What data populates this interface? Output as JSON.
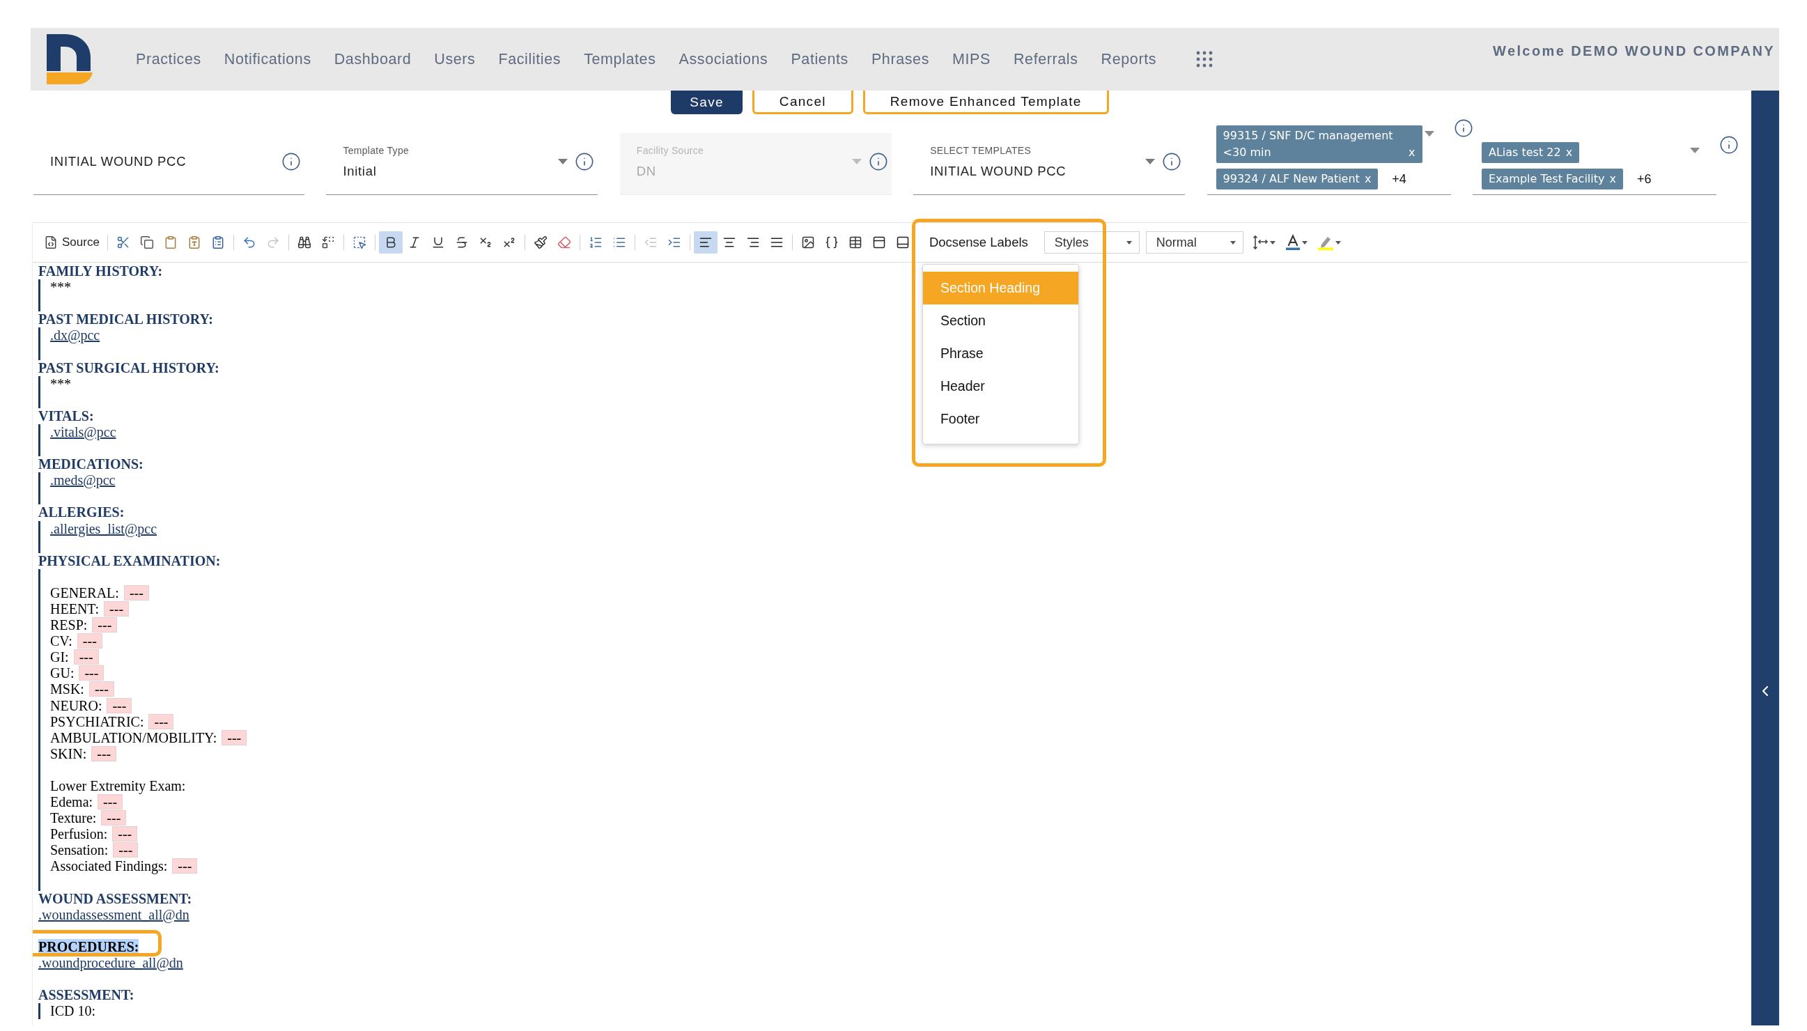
{
  "nav": {
    "items": [
      "Practices",
      "Notifications",
      "Dashboard",
      "Users",
      "Facilities",
      "Templates",
      "Associations",
      "Patients",
      "Phrases",
      "MIPS",
      "Referrals",
      "Reports"
    ],
    "welcome": "Welcome DEMO WOUND COMPANY"
  },
  "actions": [
    {
      "label": "Save",
      "kind": "primary"
    },
    {
      "label": "Cancel",
      "kind": "outline"
    },
    {
      "label": "Remove Enhanced Template",
      "kind": "outline"
    }
  ],
  "fields": [
    {
      "kind": "text",
      "value": "INITIAL WOUND PCC",
      "disabled": false
    },
    {
      "kind": "select",
      "label": "Template Type",
      "value": "Initial",
      "disabled": false
    },
    {
      "kind": "select",
      "label": "Facility Source",
      "value": "DN",
      "disabled": true
    },
    {
      "kind": "select",
      "label": "SELECT TEMPLATES",
      "value": "INITIAL WOUND PCC",
      "disabled": false
    },
    {
      "kind": "multiselect",
      "disabled": false,
      "chips": [
        {
          "label": "99315 / SNF D/C management <30 min",
          "remove": "x"
        },
        {
          "label": "99324 / ALF New Patient",
          "remove": "x"
        }
      ],
      "more": "+4"
    },
    {
      "kind": "multiselect",
      "disabled": false,
      "chips": [
        {
          "label": "ALias test 22",
          "remove": "x"
        },
        {
          "label": "Example Test Facility",
          "remove": "x"
        }
      ],
      "more": "+6"
    }
  ],
  "editor": {
    "toolbar": {
      "groups": [
        [
          {
            "kind": "source",
            "label": "Source",
            "active": false,
            "disabled": false
          }
        ],
        [
          {
            "kind": "cut",
            "active": false,
            "disabled": false
          },
          {
            "kind": "copy",
            "active": false,
            "disabled": false
          },
          {
            "kind": "paste",
            "active": false,
            "disabled": false
          },
          {
            "kind": "paste_text",
            "active": false,
            "disabled": false
          },
          {
            "kind": "paste_word",
            "active": false,
            "disabled": false
          }
        ],
        [
          {
            "kind": "undo",
            "active": false,
            "disabled": false
          },
          {
            "kind": "redo",
            "active": false,
            "disabled": true
          }
        ],
        [
          {
            "kind": "find",
            "active": false,
            "disabled": false
          },
          {
            "kind": "replace",
            "active": false,
            "disabled": false
          }
        ],
        [
          {
            "kind": "select_all",
            "active": false,
            "disabled": false
          }
        ],
        [
          {
            "kind": "bold",
            "active": true,
            "disabled": false
          },
          {
            "kind": "italic",
            "active": false,
            "disabled": false
          },
          {
            "kind": "underline",
            "active": false,
            "disabled": false
          },
          {
            "kind": "strike",
            "active": false,
            "disabled": false
          },
          {
            "kind": "subscript",
            "active": false,
            "disabled": false
          },
          {
            "kind": "superscript",
            "active": false,
            "disabled": false
          }
        ],
        [
          {
            "kind": "copy_format",
            "active": false,
            "disabled": false
          },
          {
            "kind": "remove_format",
            "active": false,
            "disabled": false
          }
        ],
        [
          {
            "kind": "numbered_list",
            "active": false,
            "disabled": false
          },
          {
            "kind": "bulleted_list",
            "active": false,
            "disabled": false
          }
        ],
        [
          {
            "kind": "outdent",
            "active": false,
            "disabled": true
          },
          {
            "kind": "indent",
            "active": false,
            "disabled": false
          }
        ],
        [
          {
            "kind": "align_left",
            "active": true,
            "disabled": false
          },
          {
            "kind": "align_center",
            "active": false,
            "disabled": false
          },
          {
            "kind": "align_right",
            "active": false,
            "disabled": false
          },
          {
            "kind": "align_justify",
            "active": false,
            "disabled": false
          }
        ],
        [
          {
            "kind": "image",
            "active": false,
            "disabled": false
          },
          {
            "kind": "placeholder",
            "active": false,
            "disabled": false
          },
          {
            "kind": "table",
            "active": false,
            "disabled": false
          },
          {
            "kind": "header_block",
            "active": false,
            "disabled": false
          },
          {
            "kind": "footer_block",
            "active": false,
            "disabled": false
          }
        ]
      ],
      "labels_menu": {
        "label": "Docsense Labels",
        "annotated": true,
        "items": [
          {
            "label": "Section Heading",
            "selected": true
          },
          {
            "label": "Section",
            "selected": false
          },
          {
            "label": "Phrase",
            "selected": false
          },
          {
            "label": "Header",
            "selected": false
          },
          {
            "label": "Footer",
            "selected": false
          }
        ]
      },
      "combos": [
        {
          "value": "Styles"
        },
        {
          "value": "Normal"
        }
      ],
      "tools": [
        {
          "kind": "line_height",
          "active": false
        },
        {
          "kind": "text_color",
          "active": false
        },
        {
          "kind": "bg_color",
          "active": false
        }
      ]
    },
    "sections": [
      {
        "heading": "FAMILY HISTORY:",
        "selected": false,
        "annotated": false,
        "indented": true,
        "lines": [
          {
            "kind": "text",
            "text": "***"
          }
        ]
      },
      {
        "heading": "PAST MEDICAL HISTORY:",
        "selected": false,
        "annotated": false,
        "indented": true,
        "lines": [
          {
            "kind": "link",
            "text": ".dx@pcc"
          }
        ]
      },
      {
        "heading": "PAST SURGICAL HISTORY:",
        "selected": false,
        "annotated": false,
        "indented": true,
        "lines": [
          {
            "kind": "text",
            "text": "***"
          }
        ]
      },
      {
        "heading": "VITALS:",
        "selected": false,
        "annotated": false,
        "indented": true,
        "lines": [
          {
            "kind": "link",
            "text": ".vitals@pcc"
          }
        ]
      },
      {
        "heading": "MEDICATIONS:",
        "selected": false,
        "annotated": false,
        "indented": true,
        "lines": [
          {
            "kind": "link",
            "text": ".meds@pcc"
          }
        ]
      },
      {
        "heading": "ALLERGIES:",
        "selected": false,
        "annotated": false,
        "indented": true,
        "lines": [
          {
            "kind": "link",
            "text": ".allergies_list@pcc"
          }
        ]
      },
      {
        "heading": "PHYSICAL EXAMINATION:",
        "selected": false,
        "annotated": false,
        "indented": true,
        "lines": [
          {
            "kind": "break"
          },
          {
            "kind": "field",
            "label": "GENERAL:",
            "value": "---"
          },
          {
            "kind": "field",
            "label": "HEENT:",
            "value": "---"
          },
          {
            "kind": "field",
            "label": "RESP:",
            "value": "---"
          },
          {
            "kind": "field",
            "label": "CV:",
            "value": "---"
          },
          {
            "kind": "field",
            "label": "GI:",
            "value": "---"
          },
          {
            "kind": "field",
            "label": "GU:",
            "value": "---"
          },
          {
            "kind": "field",
            "label": "MSK:",
            "value": "---"
          },
          {
            "kind": "field",
            "label": "NEURO:",
            "value": "---"
          },
          {
            "kind": "field",
            "label": "PSYCHIATRIC:",
            "value": "---"
          },
          {
            "kind": "field",
            "label": "AMBULATION/MOBILITY:",
            "value": "---"
          },
          {
            "kind": "field",
            "label": "SKIN:",
            "value": "---"
          },
          {
            "kind": "break"
          },
          {
            "kind": "text",
            "text": "Lower Extremity Exam:"
          },
          {
            "kind": "field",
            "label": "Edema:",
            "value": "---"
          },
          {
            "kind": "field",
            "label": "Texture:",
            "value": "---"
          },
          {
            "kind": "field",
            "label": "Perfusion:",
            "value": "---"
          },
          {
            "kind": "field",
            "label": "Sensation:",
            "value": "---"
          },
          {
            "kind": "field",
            "label": "Associated Findings:",
            "value": "---"
          }
        ]
      },
      {
        "heading": "WOUND ASSESSMENT:",
        "selected": false,
        "annotated": false,
        "indented": false,
        "lines": [
          {
            "kind": "link",
            "text": ".woundassessment_all@dn"
          }
        ]
      },
      {
        "heading": "PROCEDURES:",
        "selected": true,
        "annotated": true,
        "indented": false,
        "lines": [
          {
            "kind": "link",
            "text": ".woundprocedure_all@dn"
          }
        ]
      },
      {
        "heading": "ASSESSMENT:",
        "selected": false,
        "annotated": false,
        "indented": true,
        "lines": [
          {
            "kind": "text",
            "text": "ICD 10:"
          }
        ]
      }
    ]
  }
}
